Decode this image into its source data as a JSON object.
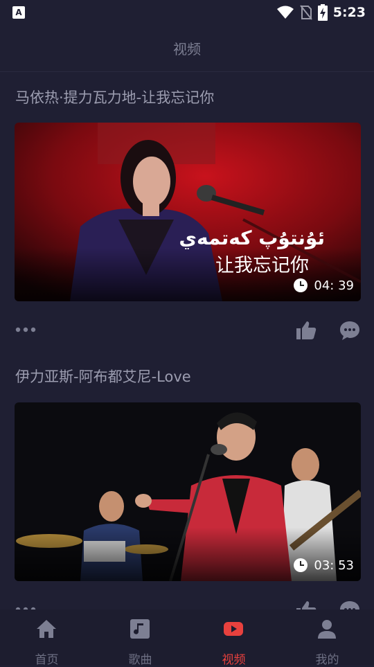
{
  "status_bar": {
    "left_icon_letter": "A",
    "time": "5:23",
    "icons": [
      "wifi-icon",
      "no-sim-icon",
      "battery-charging-icon"
    ]
  },
  "header": {
    "title": "视频"
  },
  "videos": [
    {
      "title": "马依热·提力瓦力地-让我忘记你",
      "thumbnail_caption_uyghur": "ئۇنتۇپ كەتمەي",
      "thumbnail_caption_chinese": "让我忘记你",
      "duration": "04: 39"
    },
    {
      "title": "伊力亚斯-阿布都艾尼-Love",
      "duration": "03: 53"
    }
  ],
  "bottom_nav": {
    "items": [
      {
        "label": "首页",
        "icon": "home-icon",
        "active": false
      },
      {
        "label": "歌曲",
        "icon": "music-note-icon",
        "active": false
      },
      {
        "label": "视频",
        "icon": "video-play-icon",
        "active": true
      },
      {
        "label": "我的",
        "icon": "user-icon",
        "active": false
      }
    ]
  },
  "colors": {
    "background": "#1f1f33",
    "accent": "#e8413e",
    "text_muted": "#9c9db0",
    "icon_muted": "#7d7f93"
  }
}
